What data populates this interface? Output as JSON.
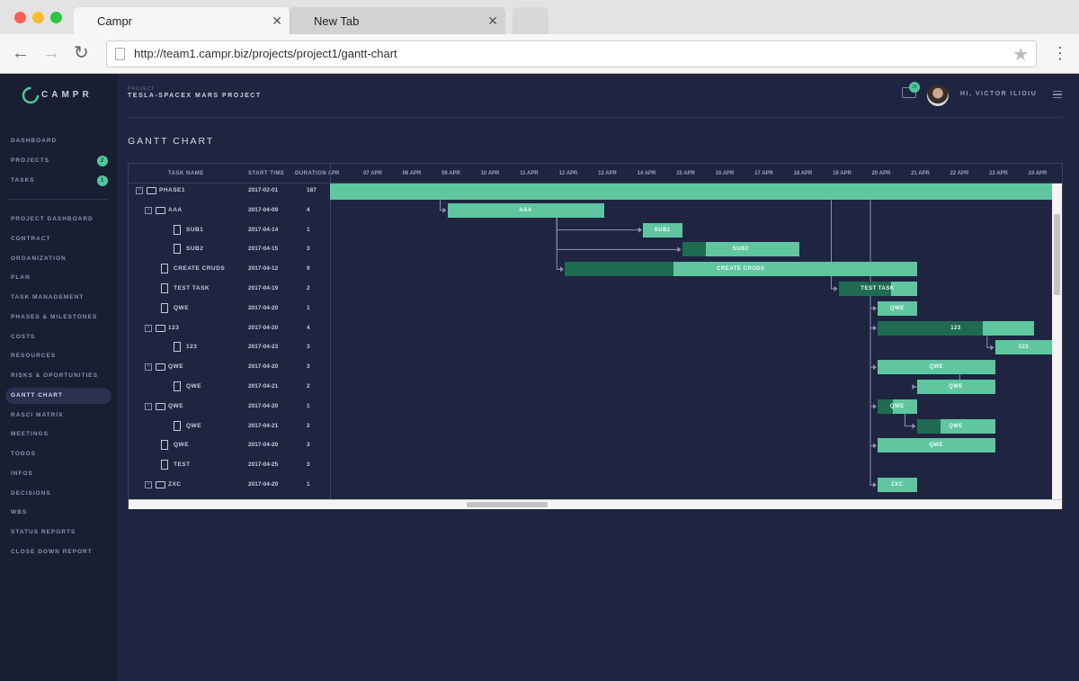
{
  "browser": {
    "tabs": [
      {
        "label": "Campr",
        "close": "✕"
      },
      {
        "label": "New Tab",
        "close": "✕"
      }
    ],
    "url": "http://team1.campr.biz/projects/project1/gantt-chart",
    "back_icon": "←",
    "forward_icon": "→",
    "reload_icon": "↻",
    "star_icon": "★",
    "menu_icon": "⋮"
  },
  "sidebar": {
    "logo": "CAMPR",
    "items_top": [
      {
        "label": "DASHBOARD"
      },
      {
        "label": "PROJECTS",
        "badge": "2"
      },
      {
        "label": "TASKS",
        "badge": "1"
      }
    ],
    "items": [
      {
        "label": "PROJECT DASHBOARD"
      },
      {
        "label": "CONTRACT"
      },
      {
        "label": "ORGANIZATION"
      },
      {
        "label": "PLAN"
      },
      {
        "label": "TASK MANAGEMENT"
      },
      {
        "label": "PHASES & MILESTONES"
      },
      {
        "label": "COSTS"
      },
      {
        "label": "RESOURCES"
      },
      {
        "label": "RISKS & OPORTUNITIES"
      },
      {
        "label": "GANTT CHART"
      },
      {
        "label": "RASCI MATRIX"
      },
      {
        "label": "MEETINGS"
      },
      {
        "label": "TODOS"
      },
      {
        "label": "INFOS"
      },
      {
        "label": "DECISIONS"
      },
      {
        "label": "WBS"
      },
      {
        "label": "STATUS REPORTS"
      },
      {
        "label": "CLOSE DOWN REPORT"
      }
    ]
  },
  "header": {
    "project_label": "PROJECT",
    "project_name": "TESLA-SPACEX MARS PROJECT",
    "messages_badge": "26",
    "greeting": "HI, VICTOR ILIOIU"
  },
  "page_title": "GANTT CHART",
  "gantt": {
    "columns": {
      "task": "TASK NAME",
      "start": "START TIME",
      "duration": "DURATION"
    },
    "dates": [
      "APR",
      "07 APR",
      "08 APR",
      "09 APR",
      "10 APR",
      "11 APR",
      "12 APR",
      "13 APR",
      "14 APR",
      "15 APR",
      "16 APR",
      "17 APR",
      "18 APR",
      "19 APR",
      "20 APR",
      "21 APR",
      "22 APR",
      "23 APR",
      "24 APR"
    ],
    "rows": [
      {
        "name": "PHASE1",
        "start": "2017-02-01",
        "duration": "187",
        "type": "folder",
        "level": 0
      },
      {
        "name": "AAA",
        "start": "2017-04-09",
        "duration": "4",
        "type": "folder",
        "level": 1
      },
      {
        "name": "SUB1",
        "start": "2017-04-14",
        "duration": "1",
        "type": "file",
        "level": 2
      },
      {
        "name": "SUB2",
        "start": "2017-04-15",
        "duration": "3",
        "type": "file",
        "level": 2
      },
      {
        "name": "CREATE CRUDS",
        "start": "2017-04-12",
        "duration": "9",
        "type": "file",
        "level": 1
      },
      {
        "name": "TEST TASK",
        "start": "2017-04-19",
        "duration": "2",
        "type": "file",
        "level": 1
      },
      {
        "name": "QWE",
        "start": "2017-04-20",
        "duration": "1",
        "type": "file",
        "level": 1
      },
      {
        "name": "123",
        "start": "2017-04-20",
        "duration": "4",
        "type": "folder",
        "level": 1
      },
      {
        "name": "123",
        "start": "2017-04-23",
        "duration": "3",
        "type": "file",
        "level": 2
      },
      {
        "name": "QWE",
        "start": "2017-04-20",
        "duration": "3",
        "type": "folder",
        "level": 1
      },
      {
        "name": "QWE",
        "start": "2017-04-21",
        "duration": "2",
        "type": "file",
        "level": 2
      },
      {
        "name": "QWE",
        "start": "2017-04-20",
        "duration": "1",
        "type": "folder",
        "level": 1
      },
      {
        "name": "QWE",
        "start": "2017-04-21",
        "duration": "2",
        "type": "file",
        "level": 2
      },
      {
        "name": "QWE",
        "start": "2017-04-20",
        "duration": "3",
        "type": "file",
        "level": 1
      },
      {
        "name": "TEST",
        "start": "2017-04-25",
        "duration": "3",
        "type": "file",
        "level": 1
      },
      {
        "name": "ZXC",
        "start": "2017-04-20",
        "duration": "1",
        "type": "folder",
        "level": 1
      }
    ],
    "bar_labels": [
      "",
      "AAA",
      "SUB1",
      "SUB2",
      "CREATE CRUDS",
      "TEST TASK",
      "QWE",
      "123",
      "123",
      "QWE",
      "QWE",
      "QWE",
      "QWE",
      "QWE",
      "",
      "ZXC"
    ],
    "progress": [
      0,
      0,
      0,
      0.2,
      0.31,
      0.67,
      0,
      0.67,
      0,
      0,
      0,
      0.38,
      0.3,
      0,
      0,
      0
    ]
  },
  "colors": {
    "bar": "#5fc6a0",
    "progress": "#1f6b52",
    "accent": "#4fc89c",
    "background": "#1f2540"
  }
}
